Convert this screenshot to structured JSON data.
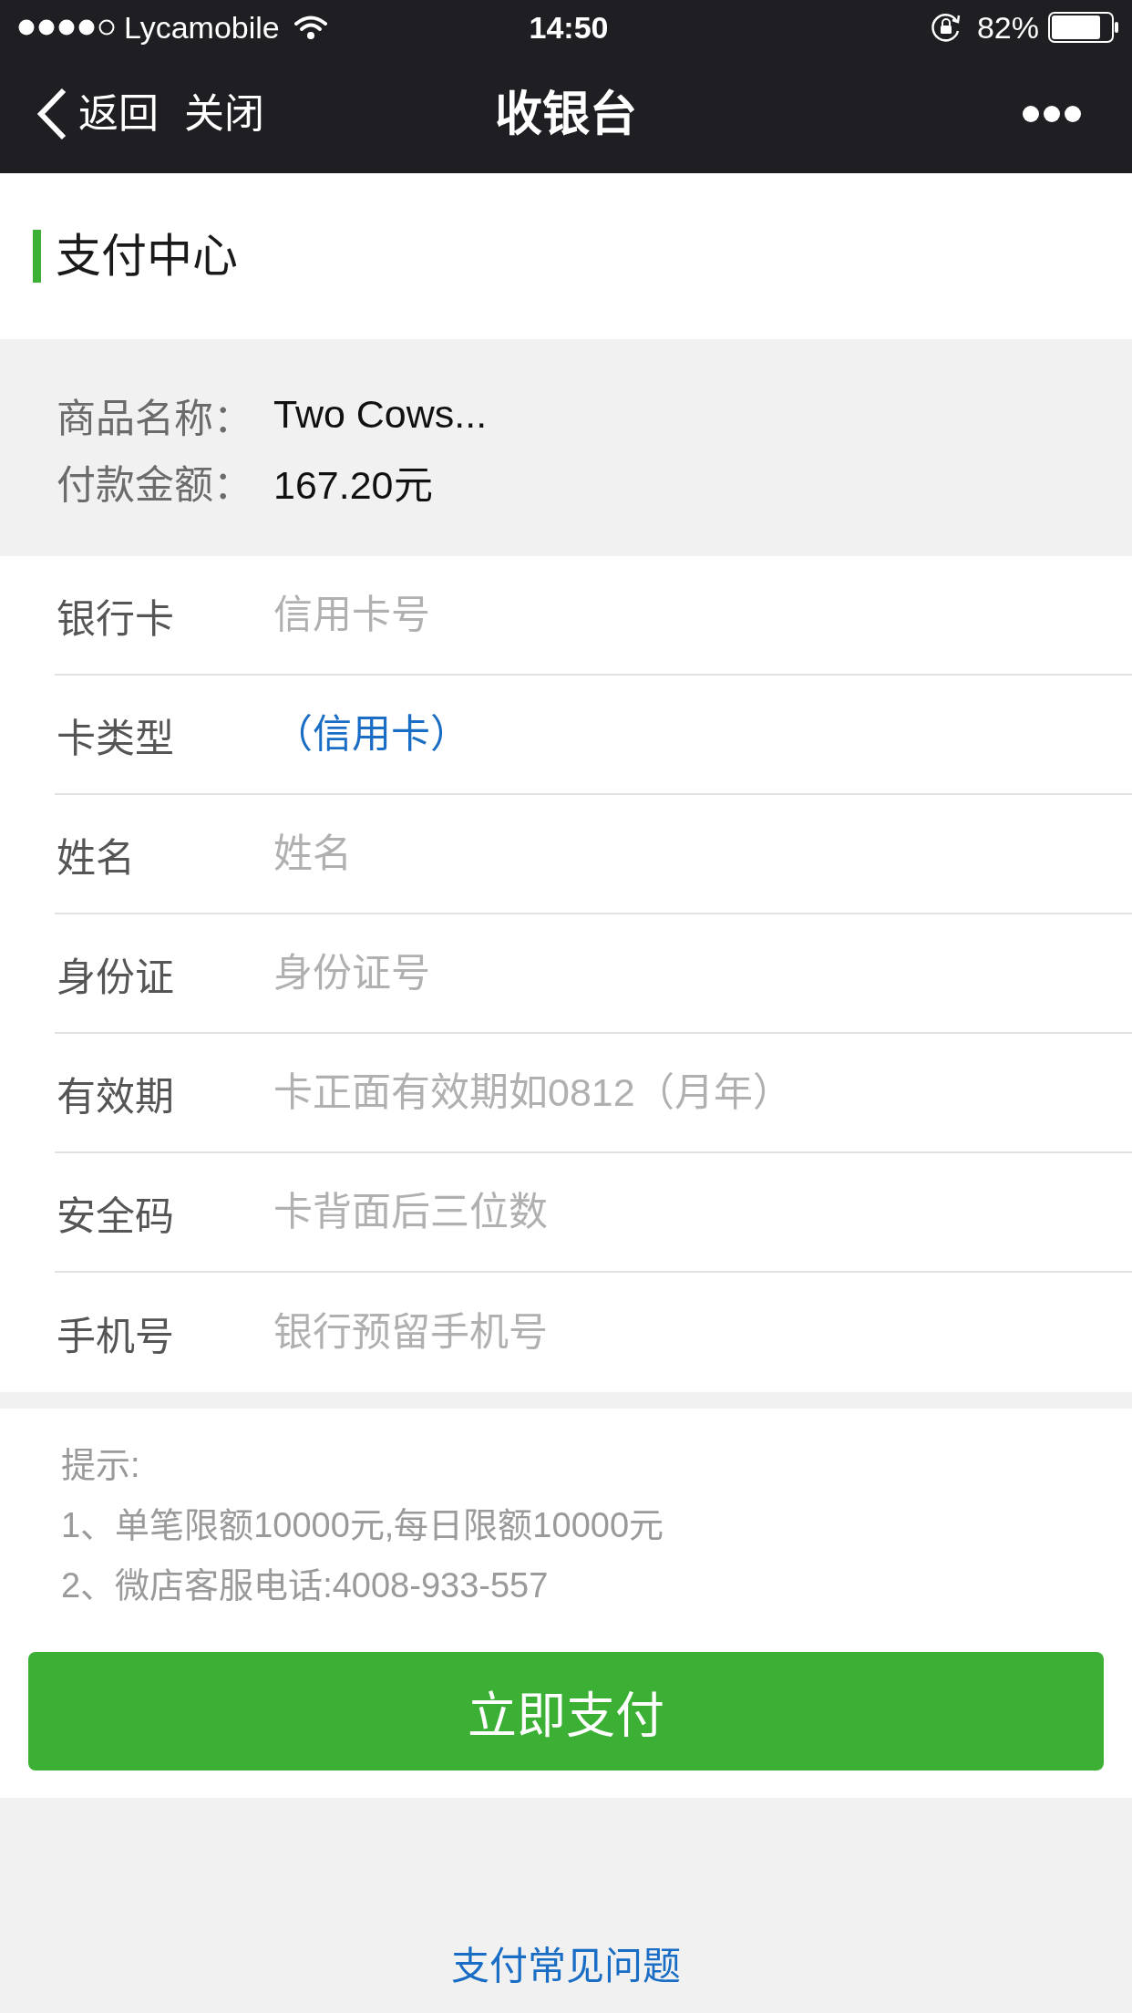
{
  "status_bar": {
    "carrier": "Lycamobile",
    "time": "14:50",
    "battery": "82%"
  },
  "nav_bar": {
    "back": "返回",
    "close": "关闭",
    "title": "收银台"
  },
  "section_title": "支付中心",
  "order_summary": [
    {
      "label": "商品名称：",
      "value": "Two Cows..."
    },
    {
      "label": "付款金额：",
      "value": "167.20元"
    }
  ],
  "card_form": {
    "fields": [
      {
        "kind": "input",
        "label": "银行卡",
        "placeholder": "信用卡号"
      },
      {
        "kind": "select",
        "label": "卡类型",
        "value": "（信用卡）"
      },
      {
        "kind": "input",
        "label": "姓名",
        "placeholder": "姓名"
      },
      {
        "kind": "input",
        "label": "身份证",
        "placeholder": "身份证号"
      },
      {
        "kind": "input",
        "label": "有效期",
        "placeholder": "卡正面有效期如0812（月年）"
      },
      {
        "kind": "input",
        "label": "安全码",
        "placeholder": "卡背面后三位数"
      },
      {
        "kind": "input",
        "label": "手机号",
        "placeholder": "银行预留手机号"
      }
    ]
  },
  "tips": {
    "heading": "提示:",
    "lines": [
      "1、单笔限额10000元,每日限额10000元",
      "2、微店客服电话:4008-933-557"
    ]
  },
  "pay_button": "立即支付",
  "faq_link": "支付常见问题"
}
